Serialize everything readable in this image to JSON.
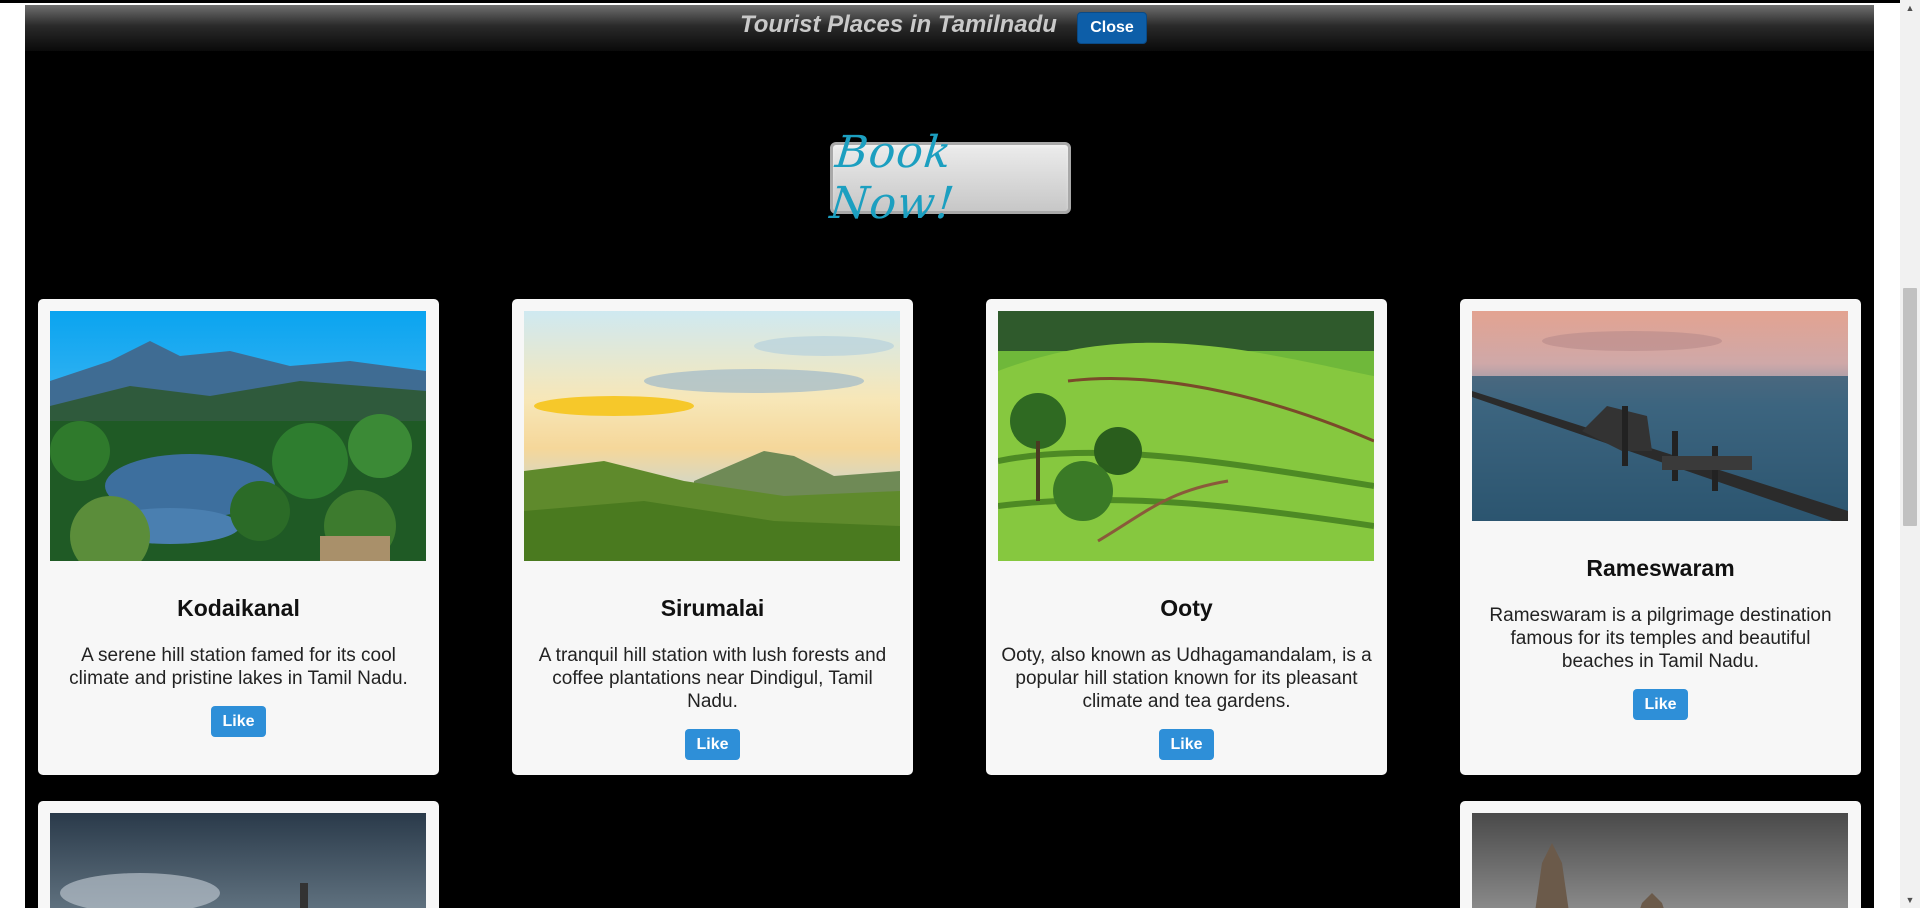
{
  "header": {
    "title": "Tourist Places in Tamilnadu",
    "close_label": "Close"
  },
  "book_now": {
    "label": "Book Now!"
  },
  "cards": [
    {
      "title": "Kodaikanal",
      "description": "A serene hill station famed for its cool climate and pristine lakes in Tamil Nadu.",
      "like_label": "Like"
    },
    {
      "title": "Sirumalai",
      "description": "A tranquil hill station with lush forests and coffee plantations near Dindigul, Tamil Nadu.",
      "like_label": "Like"
    },
    {
      "title": "Ooty",
      "description": "Ooty, also known as Udhagamandalam, is a popular hill station known for its pleasant climate and tea gardens.",
      "like_label": "Like"
    },
    {
      "title": "Rameswaram",
      "description": "Rameswaram is a pilgrimage destination famous for its temples and beautiful beaches in Tamil Nadu.",
      "like_label": "Like"
    }
  ],
  "scrollbar": {
    "scroll_position_fraction": 0.33
  },
  "colors": {
    "page_background": "#000000",
    "card_background": "#f7f7f7",
    "like_button": "#2e8fd8",
    "close_button": "#0d5ea8",
    "book_now_text": "#1c9fc0"
  }
}
